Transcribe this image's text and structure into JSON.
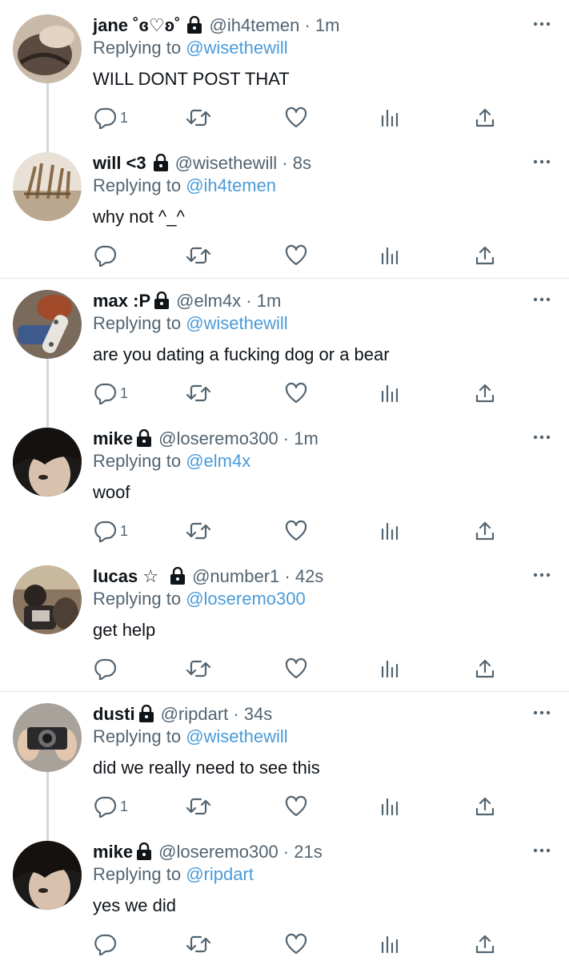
{
  "colors": {
    "mention": "#4a9bd9",
    "secondary_text": "#536471",
    "primary_text": "#0f1419",
    "thread_line": "#cfd9de"
  },
  "tweets": [
    {
      "name": "jane ˚ɞ♡ʚ˚",
      "handle": "@ih4temen",
      "time": "1m",
      "replying_prefix": "Replying to",
      "replying_to": "@wisethewill",
      "text": "WILL DONT POST THAT",
      "reply_count": "1",
      "avatar_icon": "profile-photo"
    },
    {
      "name": "will <3",
      "handle": "@wisethewill",
      "time": "8s",
      "replying_prefix": "Replying to",
      "replying_to": "@ih4temen",
      "text": "why not ^_^",
      "reply_count": "",
      "avatar_icon": "profile-photo"
    },
    {
      "name": "max :P",
      "handle": "@elm4x",
      "time": "1m",
      "replying_prefix": "Replying to",
      "replying_to": "@wisethewill",
      "text": "are you dating a fucking dog or a bear",
      "reply_count": "1",
      "avatar_icon": "profile-photo"
    },
    {
      "name": "mike",
      "handle": "@loseremo300",
      "time": "1m",
      "replying_prefix": "Replying to",
      "replying_to": "@elm4x",
      "text": "woof",
      "reply_count": "1",
      "avatar_icon": "profile-photo"
    },
    {
      "name": "lucas ☆",
      "handle": "@number1",
      "time": "42s",
      "replying_prefix": "Replying to",
      "replying_to": "@loseremo300",
      "text": "get help",
      "reply_count": "",
      "avatar_icon": "profile-photo"
    },
    {
      "name": "dusti",
      "handle": "@ripdart",
      "time": "34s",
      "replying_prefix": "Replying to",
      "replying_to": "@wisethewill",
      "text": "did we really need to see this",
      "reply_count": "1",
      "avatar_icon": "profile-photo"
    },
    {
      "name": "mike",
      "handle": "@loseremo300",
      "time": "21s",
      "replying_prefix": "Replying to",
      "replying_to": "@ripdart",
      "text": "yes we did",
      "reply_count": "",
      "avatar_icon": "profile-photo"
    }
  ]
}
